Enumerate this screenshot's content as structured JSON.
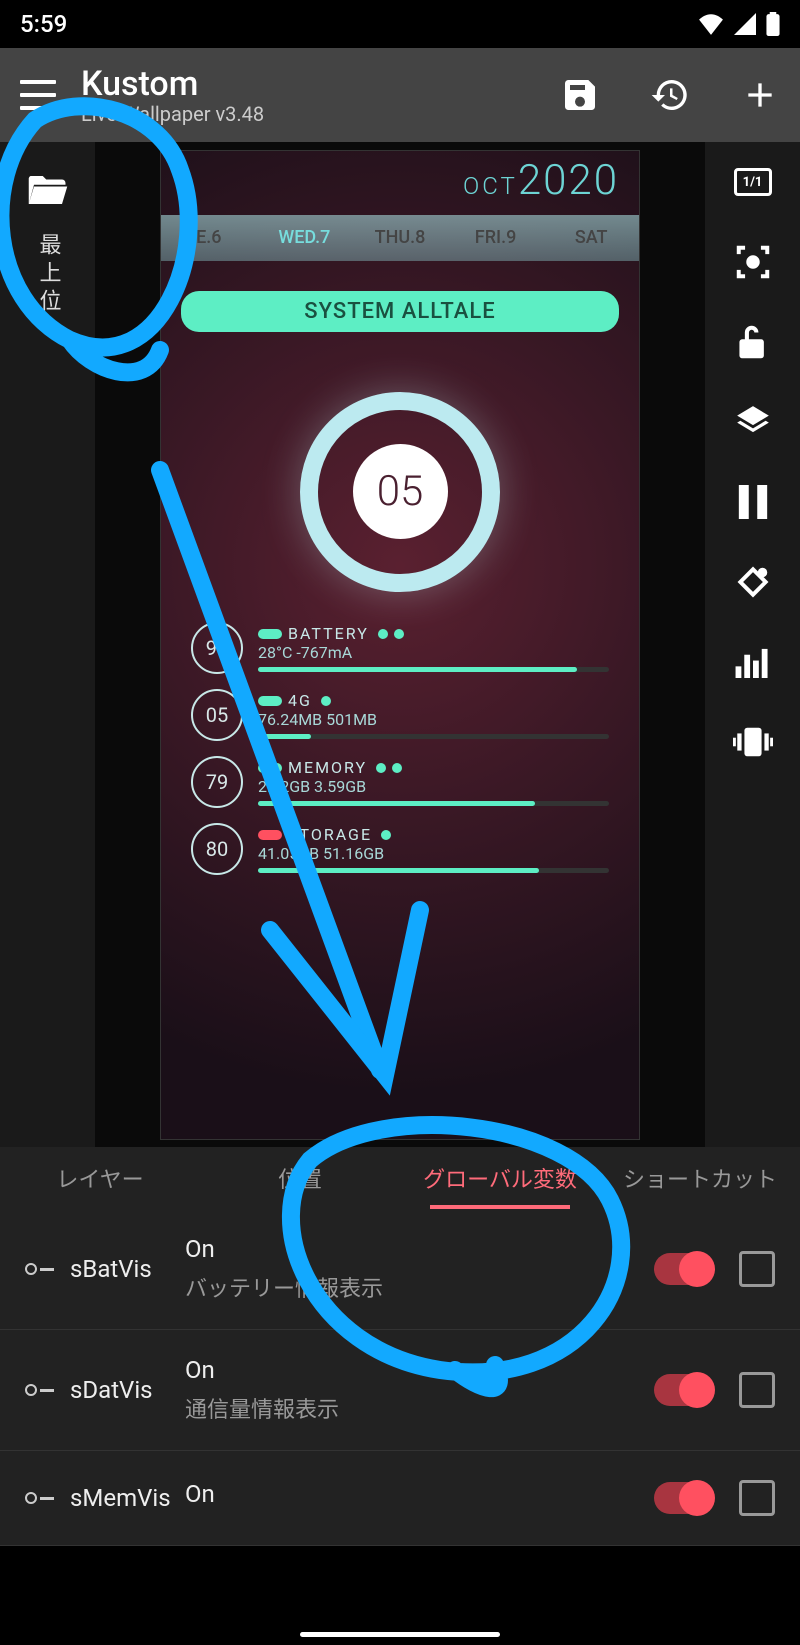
{
  "statusbar": {
    "time": "5:59"
  },
  "appbar": {
    "title": "Kustom",
    "subtitle": "Live Wallpaper v3.48"
  },
  "left": {
    "label": "最上位"
  },
  "right_icons": {
    "counter": "1/1"
  },
  "wallpaper": {
    "month": "OCT",
    "year": "2020",
    "days": [
      "E.6",
      "WED.7",
      "THU.8",
      "FRI.9",
      "SAT"
    ],
    "banner": "SYSTEM ALLTALE",
    "ring_value": "05",
    "stats": [
      {
        "n": "91",
        "label": "BATTERY",
        "value": "28°C  -767mA"
      },
      {
        "n": "05",
        "label": "4G",
        "value": "76.24MB  501MB"
      },
      {
        "n": "79",
        "label": "MEMORY",
        "value": "2.92GB  3.59GB"
      },
      {
        "n": "80",
        "label": "STORAGE",
        "value": "41.05GB  51.16GB"
      }
    ]
  },
  "tabs": [
    "レイヤー",
    "位置",
    "グローバル変数",
    "ショートカット"
  ],
  "items": [
    {
      "key": "sBatVis",
      "state": "On",
      "desc": "バッテリー情報表示"
    },
    {
      "key": "sDatVis",
      "state": "On",
      "desc": "通信量情報表示"
    },
    {
      "key": "sMemVis",
      "state": "On",
      "desc": ""
    }
  ]
}
